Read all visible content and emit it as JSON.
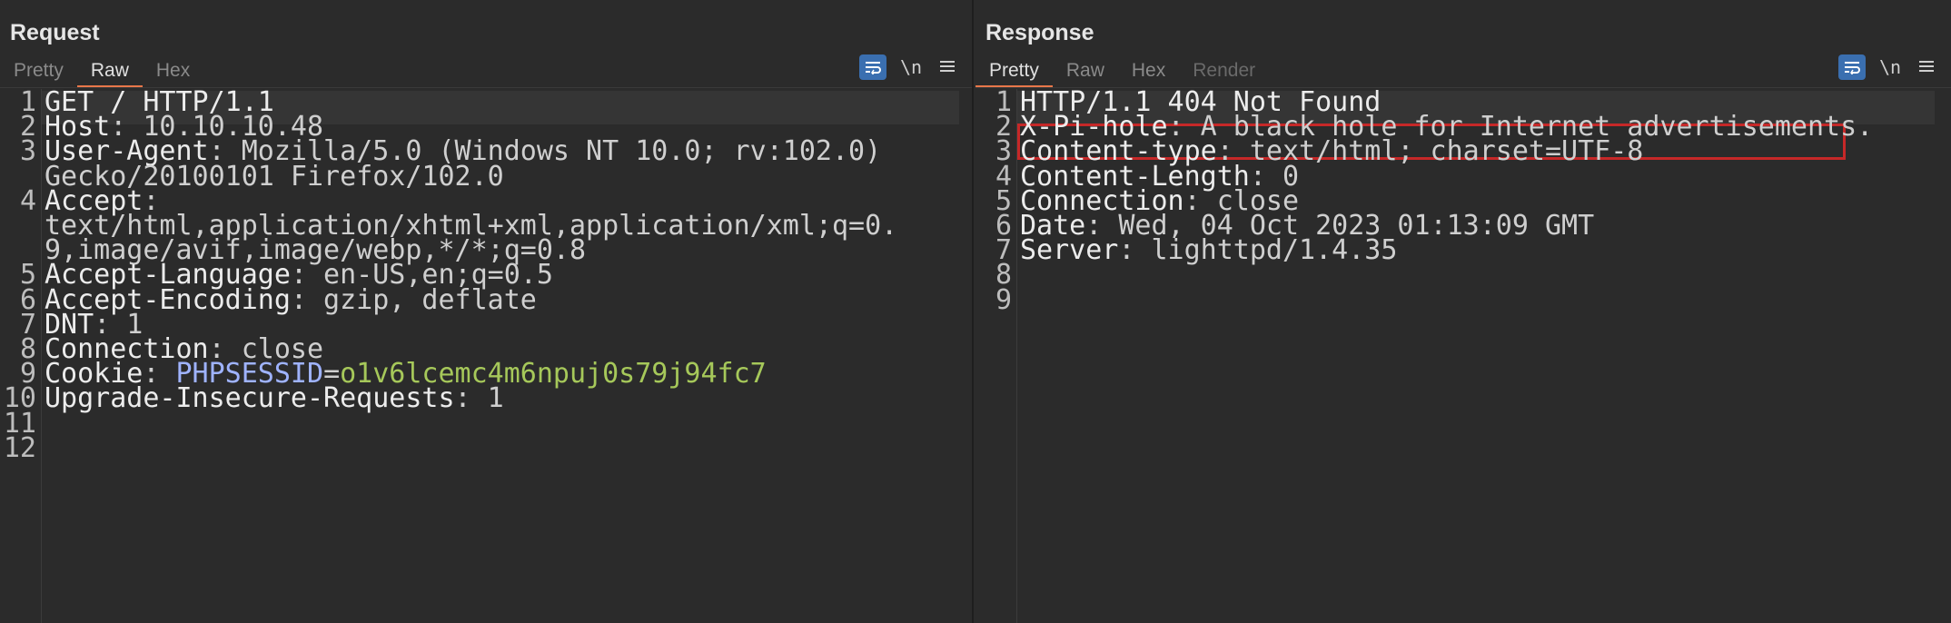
{
  "request": {
    "title": "Request",
    "tabs": [
      {
        "label": "Pretty",
        "state": "inactive"
      },
      {
        "label": "Raw",
        "state": "active"
      },
      {
        "label": "Hex",
        "state": "inactive"
      }
    ],
    "tools": {
      "wrap_icon": "wrap-lines-icon",
      "newline_label": "\\n",
      "menu_icon": "menu-icon"
    },
    "lines": [
      {
        "n": "1",
        "parts": [
          {
            "t": "GET / HTTP/1.1",
            "c": "key"
          }
        ]
      },
      {
        "n": "2",
        "parts": [
          {
            "t": "Host",
            "c": "key"
          },
          {
            "t": ": 10.10.10.48",
            "c": "val"
          }
        ]
      },
      {
        "n": "3",
        "parts": [
          {
            "t": "User-Agent",
            "c": "key"
          },
          {
            "t": ": Mozilla/5.0 (Windows NT 10.0; rv:102.0)",
            "c": "val"
          }
        ]
      },
      {
        "n": "",
        "parts": [
          {
            "t": "Gecko/20100101 Firefox/102.0",
            "c": "val"
          }
        ]
      },
      {
        "n": "4",
        "parts": [
          {
            "t": "Accept",
            "c": "key"
          },
          {
            "t": ":",
            "c": "val"
          }
        ]
      },
      {
        "n": "",
        "parts": [
          {
            "t": "text/html,application/xhtml+xml,application/xml;q=0.",
            "c": "val"
          }
        ]
      },
      {
        "n": "",
        "parts": [
          {
            "t": "9,image/avif,image/webp,*/*;q=0.8",
            "c": "val"
          }
        ]
      },
      {
        "n": "5",
        "parts": [
          {
            "t": "Accept-Language",
            "c": "key"
          },
          {
            "t": ": en-US,en;q=0.5",
            "c": "val"
          }
        ]
      },
      {
        "n": "6",
        "parts": [
          {
            "t": "Accept-Encoding",
            "c": "key"
          },
          {
            "t": ": gzip, deflate",
            "c": "val"
          }
        ]
      },
      {
        "n": "7",
        "parts": [
          {
            "t": "DNT",
            "c": "key"
          },
          {
            "t": ": 1",
            "c": "val"
          }
        ]
      },
      {
        "n": "8",
        "parts": [
          {
            "t": "Connection",
            "c": "key"
          },
          {
            "t": ": close",
            "c": "val"
          }
        ]
      },
      {
        "n": "9",
        "parts": [
          {
            "t": "Cookie",
            "c": "key"
          },
          {
            "t": ": ",
            "c": "val"
          },
          {
            "t": "PHPSESSID",
            "c": "ck"
          },
          {
            "t": "=",
            "c": "val"
          },
          {
            "t": "o1v6lcemc4m6npuj0s79j94fc7",
            "c": "cv"
          }
        ]
      },
      {
        "n": "10",
        "parts": [
          {
            "t": "Upgrade-Insecure-Requests",
            "c": "key"
          },
          {
            "t": ": 1",
            "c": "val"
          }
        ]
      },
      {
        "n": "11",
        "parts": []
      },
      {
        "n": "12",
        "parts": []
      }
    ]
  },
  "response": {
    "title": "Response",
    "tabs": [
      {
        "label": "Pretty",
        "state": "active"
      },
      {
        "label": "Raw",
        "state": "inactive"
      },
      {
        "label": "Hex",
        "state": "inactive"
      },
      {
        "label": "Render",
        "state": "disabled"
      }
    ],
    "tools": {
      "wrap_icon": "wrap-lines-icon",
      "newline_label": "\\n",
      "menu_icon": "menu-icon"
    },
    "lines": [
      {
        "n": "1",
        "parts": [
          {
            "t": "HTTP/1.1 404 Not Found",
            "c": "key"
          }
        ]
      },
      {
        "n": "2",
        "parts": [
          {
            "t": "X-Pi-hole",
            "c": "key"
          },
          {
            "t": ": A black hole for Internet advertisements.",
            "c": "val"
          }
        ]
      },
      {
        "n": "3",
        "parts": [
          {
            "t": "Content-type",
            "c": "key"
          },
          {
            "t": ": text/html; charset=UTF-8",
            "c": "val"
          }
        ]
      },
      {
        "n": "4",
        "parts": [
          {
            "t": "Content-Length",
            "c": "key"
          },
          {
            "t": ": 0",
            "c": "val"
          }
        ]
      },
      {
        "n": "5",
        "parts": [
          {
            "t": "Connection",
            "c": "key"
          },
          {
            "t": ": close",
            "c": "val"
          }
        ]
      },
      {
        "n": "6",
        "parts": [
          {
            "t": "Date",
            "c": "key"
          },
          {
            "t": ": Wed, 04 Oct 2023 01:13:09 GMT",
            "c": "val"
          }
        ]
      },
      {
        "n": "7",
        "parts": [
          {
            "t": "Server",
            "c": "key"
          },
          {
            "t": ": lighttpd/1.4.35",
            "c": "val"
          }
        ]
      },
      {
        "n": "8",
        "parts": []
      },
      {
        "n": "9",
        "parts": []
      }
    ]
  },
  "layout_toggle": {
    "buttons": [
      {
        "icon": "split-vertical-icon",
        "active": true
      },
      {
        "icon": "split-horizontal-icon",
        "active": false
      },
      {
        "icon": "single-pane-icon",
        "active": false
      }
    ]
  },
  "colors": {
    "accent": "#e8774a",
    "highlight_box": "#c62828",
    "cookie_name": "#9fb3ff",
    "cookie_value": "#a6c85a"
  }
}
